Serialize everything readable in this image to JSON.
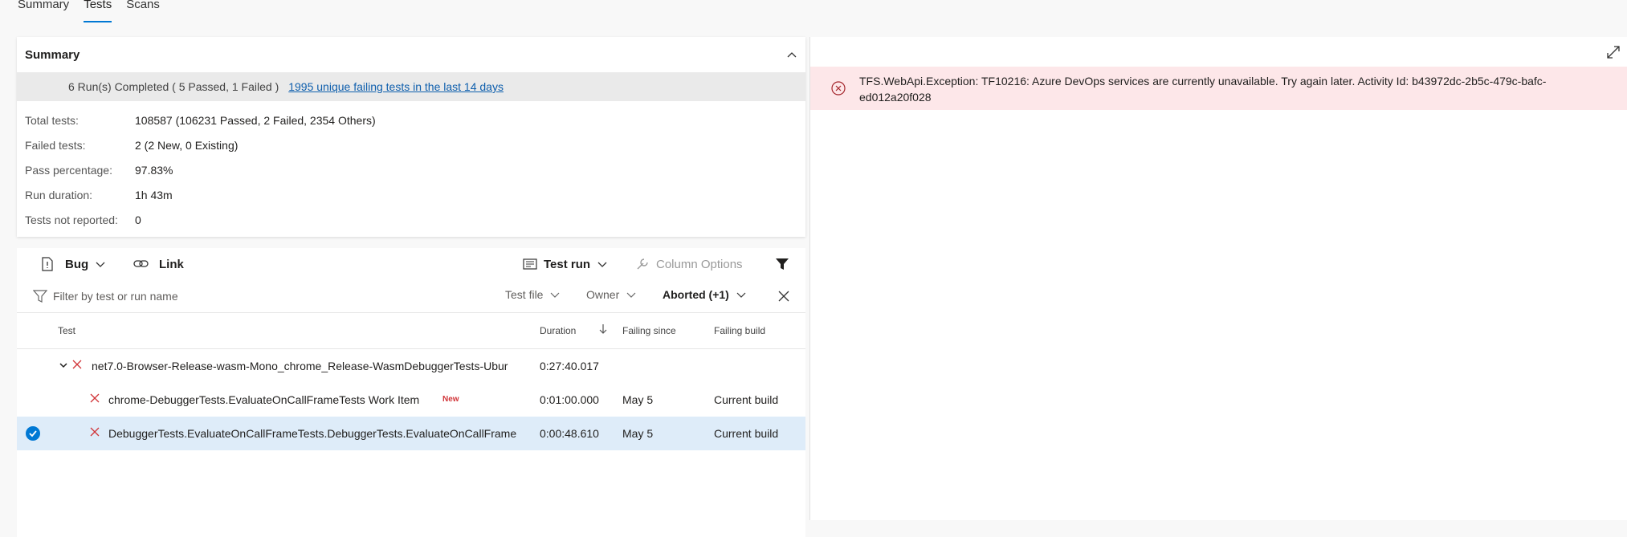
{
  "tabs": [
    {
      "label": "Summary",
      "active": false
    },
    {
      "label": "Tests",
      "active": true
    },
    {
      "label": "Scans",
      "active": false
    }
  ],
  "summary": {
    "title": "Summary",
    "banner_text": "6 Run(s) Completed ( 5 Passed, 1 Failed )",
    "banner_link": "1995 unique failing tests in the last 14 days",
    "stats": [
      {
        "key": "Total tests:",
        "value": "108587 (106231 Passed, 2 Failed, 2354 Others)"
      },
      {
        "key": "Failed tests:",
        "value": "2 (2 New, 0 Existing)"
      },
      {
        "key": "Pass percentage:",
        "value": "97.83%"
      },
      {
        "key": "Run duration:",
        "value": "1h 43m"
      },
      {
        "key": "Tests not reported:",
        "value": "0"
      }
    ]
  },
  "toolbar": {
    "bug": "Bug",
    "link": "Link",
    "test_run": "Test run",
    "column_options": "Column Options"
  },
  "filters": {
    "placeholder": "Filter by test or run name",
    "test_file": "Test file",
    "owner": "Owner",
    "outcome": "Aborted (+1)"
  },
  "columns": {
    "test": "Test",
    "duration": "Duration",
    "failing_since": "Failing since",
    "failing_build": "Failing build"
  },
  "rows": [
    {
      "name": "net7.0-Browser-Release-wasm-Mono_chrome_Release-WasmDebuggerTests-Ubur",
      "duration": "0:27:40.017",
      "since": "",
      "build": "",
      "badge": ""
    },
    {
      "name": "chrome-DebuggerTests.EvaluateOnCallFrameTests Work Item",
      "duration": "0:01:00.000",
      "since": "May 5",
      "build": "Current build",
      "badge": "New"
    },
    {
      "name": "DebuggerTests.EvaluateOnCallFrameTests.DebuggerTests.EvaluateOnCallFrame",
      "duration": "0:00:48.610",
      "since": "May 5",
      "build": "Current build",
      "badge": ""
    }
  ],
  "error": {
    "message": "TFS.WebApi.Exception: TF10216: Azure DevOps services are currently unavailable. Try again later. Activity Id: b43972dc-2b5c-479c-bafc-ed012a20f028"
  },
  "colors": {
    "accent": "#0078d4",
    "fail": "#d13438",
    "error_bg": "#fde7e9",
    "selected_row": "#deecf9"
  }
}
